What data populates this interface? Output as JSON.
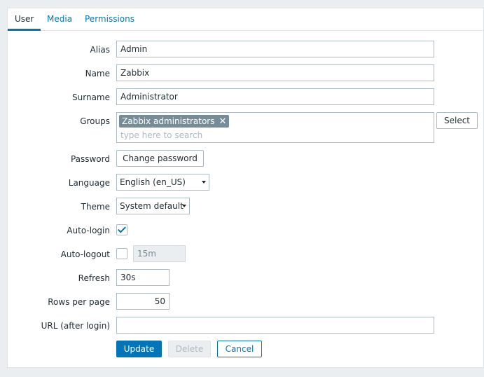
{
  "tabs": [
    {
      "label": "User",
      "active": true
    },
    {
      "label": "Media",
      "active": false
    },
    {
      "label": "Permissions",
      "active": false
    }
  ],
  "form": {
    "alias": {
      "label": "Alias",
      "value": "Admin"
    },
    "name": {
      "label": "Name",
      "value": "Zabbix"
    },
    "surname": {
      "label": "Surname",
      "value": "Administrator"
    },
    "groups": {
      "label": "Groups",
      "selected": [
        "Zabbix administrators"
      ],
      "placeholder": "type here to search",
      "select_button": "Select"
    },
    "password": {
      "label": "Password",
      "button": "Change password"
    },
    "language": {
      "label": "Language",
      "value": "English (en_US)"
    },
    "theme": {
      "label": "Theme",
      "value": "System default"
    },
    "autologin": {
      "label": "Auto-login",
      "checked": true
    },
    "autologout": {
      "label": "Auto-logout",
      "checked": false,
      "value": "15m"
    },
    "refresh": {
      "label": "Refresh",
      "value": "30s"
    },
    "rows_per_page": {
      "label": "Rows per page",
      "value": "50"
    },
    "url": {
      "label": "URL (after login)",
      "value": ""
    }
  },
  "actions": {
    "update": "Update",
    "delete": "Delete",
    "cancel": "Cancel"
  },
  "colors": {
    "accent": "#0275b8",
    "chip_bg": "#768d99",
    "page_bg": "#ebeef0"
  }
}
